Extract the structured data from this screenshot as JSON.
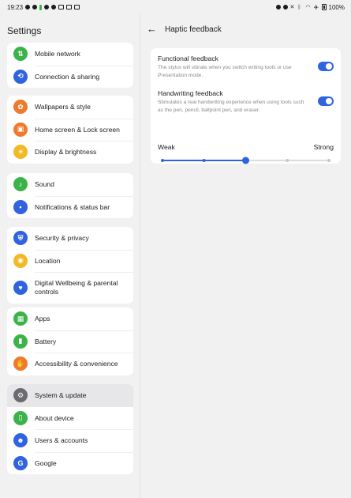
{
  "status_bar": {
    "time": "19:23",
    "battery": "100%"
  },
  "settings": {
    "title": "Settings",
    "groups": [
      {
        "items": [
          {
            "label": "Mobile network",
            "icon": "mobile-network-icon",
            "color": "#3cb34a"
          },
          {
            "label": "Connection & sharing",
            "icon": "connection-sharing-icon",
            "color": "#2f63e0"
          }
        ]
      },
      {
        "items": [
          {
            "label": "Wallpapers & style",
            "icon": "palette-icon",
            "color": "#ee7a2e"
          },
          {
            "label": "Home screen & Lock screen",
            "icon": "home-screen-icon",
            "color": "#ee7a2e"
          },
          {
            "label": "Display & brightness",
            "icon": "brightness-icon",
            "color": "#f2b926"
          }
        ]
      },
      {
        "items": [
          {
            "label": "Sound",
            "icon": "bell-icon",
            "color": "#3cb34a"
          },
          {
            "label": "Notifications & status bar",
            "icon": "notification-icon",
            "color": "#2f63e0"
          }
        ]
      },
      {
        "items": [
          {
            "label": "Security & privacy",
            "icon": "shield-icon",
            "color": "#2f63e0"
          },
          {
            "label": "Location",
            "icon": "location-pin-icon",
            "color": "#f2b926"
          },
          {
            "label": "Digital Wellbeing & parental controls",
            "icon": "heart-icon",
            "color": "#2f63e0"
          }
        ]
      },
      {
        "items": [
          {
            "label": "Apps",
            "icon": "apps-grid-icon",
            "color": "#3cb34a"
          },
          {
            "label": "Battery",
            "icon": "battery-icon",
            "color": "#3cb34a"
          },
          {
            "label": "Accessibility & convenience",
            "icon": "accessibility-hand-icon",
            "color": "#ee7a2e"
          }
        ]
      },
      {
        "items": [
          {
            "label": "System & update",
            "icon": "gear-icon",
            "color": "#6b6b70"
          },
          {
            "label": "About device",
            "icon": "device-icon",
            "color": "#3cb34a"
          },
          {
            "label": "Users & accounts",
            "icon": "user-icon",
            "color": "#2f63e0"
          },
          {
            "label": "Google",
            "icon": "google-icon",
            "color": "#2f63e0"
          }
        ]
      }
    ]
  },
  "haptic": {
    "title": "Haptic feedback",
    "functional": {
      "title": "Functional feedback",
      "description": "The stylus will vibrate when you switch writing tools or use Presentation mode.",
      "enabled": true
    },
    "handwriting": {
      "title": "Handwriting feedback",
      "description": "Stimulates a real handwriting experience when using tools such as the pen, pencil, ballpoint pen, and eraser.",
      "enabled": true
    },
    "intensity": {
      "weak_label": "Weak",
      "strong_label": "Strong",
      "steps": 5,
      "value": 3
    }
  },
  "colors": {
    "accent": "#2f63e0",
    "track_inactive": "#dcdce0",
    "tick_inactive": "#c6c6cb"
  }
}
